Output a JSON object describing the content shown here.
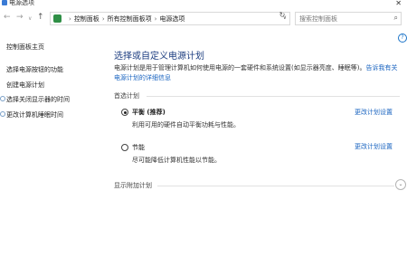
{
  "window": {
    "title": "电源选项",
    "close_glyph": "✕"
  },
  "nav": {
    "back_glyph": "←",
    "forward_glyph": "→",
    "dropdown_glyph": "∨",
    "up_glyph": "↑",
    "breadcrumb": [
      "控制面板",
      "所有控制面板项",
      "电源选项"
    ],
    "separator": "›",
    "addr_dropdown_glyph": "∨",
    "refresh_glyph": "↻",
    "search_placeholder": "搜索控制面板",
    "search_icon_glyph": "⌕"
  },
  "help_glyph": "?",
  "sidebar": {
    "items": [
      {
        "label": "控制面板主页"
      },
      {
        "label": "选择电源按钮的功能"
      },
      {
        "label": "创建电源计划"
      },
      {
        "label": "选择关闭显示器的时间"
      },
      {
        "label": "更改计算机睡眠时间"
      }
    ]
  },
  "main": {
    "title": "选择或自定义电源计划",
    "description": "电源计划是用于管理计算机如何使用电源的一套硬件和系统设置(如显示器亮度、睡眠等)。",
    "description_link": "告诉我有关电源计划的详细信息",
    "preferred_section": "首选计划",
    "plans": [
      {
        "name": "平衡 (推荐)",
        "description": "利用可用的硬件自动平衡功耗与性能。",
        "link": "更改计划设置",
        "selected": true
      },
      {
        "name": "节能",
        "description": "尽可能降低计算机性能以节能。",
        "link": "更改计划设置",
        "selected": false
      }
    ],
    "extra_section": "显示附加计划",
    "expand_glyph": "⌄"
  },
  "colors": {
    "link": "#1a64c0",
    "title": "#1c3d80"
  }
}
